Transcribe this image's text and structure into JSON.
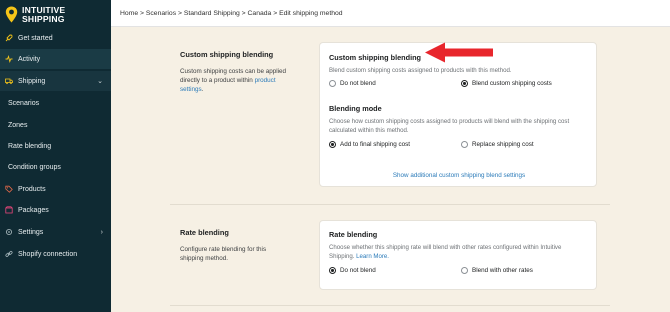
{
  "app": {
    "logo_line1": "INTUITIVE",
    "logo_line2": "SHIPPING"
  },
  "sidebar": {
    "items": [
      {
        "label": "Get started",
        "icon": "rocket-icon"
      },
      {
        "label": "Activity",
        "icon": "activity-icon"
      },
      {
        "label": "Shipping",
        "icon": "truck-icon"
      },
      {
        "label": "Scenarios"
      },
      {
        "label": "Zones"
      },
      {
        "label": "Rate blending"
      },
      {
        "label": "Condition groups"
      },
      {
        "label": "Products",
        "icon": "tag-icon"
      },
      {
        "label": "Packages",
        "icon": "package-icon"
      },
      {
        "label": "Settings",
        "icon": "gear-icon"
      },
      {
        "label": "Shopify connection",
        "icon": "link-icon"
      }
    ],
    "accent": "#f5c518"
  },
  "breadcrumb": "Home > Scenarios > Standard Shipping > Canada > Edit shipping method",
  "custom_blending": {
    "section_title": "Custom shipping blending",
    "section_desc_1": "Custom shipping costs can be applied",
    "section_desc_2": "directly to a product within",
    "section_desc_link": "product",
    "section_desc_3": "settings",
    "section_desc_end": ".",
    "card_title": "Custom shipping blending",
    "card_text": "Blend custom shipping costs assigned to products with this method.",
    "option_no": "Do not blend",
    "option_yes": "Blend custom shipping costs",
    "selected": "Blend custom shipping costs",
    "mode_title": "Blending mode",
    "mode_text_1": "Choose how custom shipping costs assigned to products will blend with the shipping cost",
    "mode_text_2": "calculated within this method.",
    "mode_add": "Add to final shipping cost",
    "mode_replace": "Replace shipping cost",
    "mode_selected": "Add to final shipping cost",
    "show_more": "Show additional custom shipping blend settings"
  },
  "rate_blending": {
    "section_title": "Rate blending",
    "section_desc_1": "Configure rate blending for this",
    "section_desc_2": "shipping method.",
    "card_title": "Rate blending",
    "card_text_1": "Choose whether this shipping rate will blend with other rates configured within Intuitive",
    "card_text_2": "Shipping.",
    "learn_more": "Learn More.",
    "option_no": "Do not blend",
    "option_yes": "Blend with other rates",
    "selected": "Do not blend"
  },
  "colors": {
    "sidebar_bg": "#0f2a33",
    "page_bg": "#f6f0e4",
    "link": "#2b7bb9",
    "annotation_arrow": "#e8262c"
  }
}
